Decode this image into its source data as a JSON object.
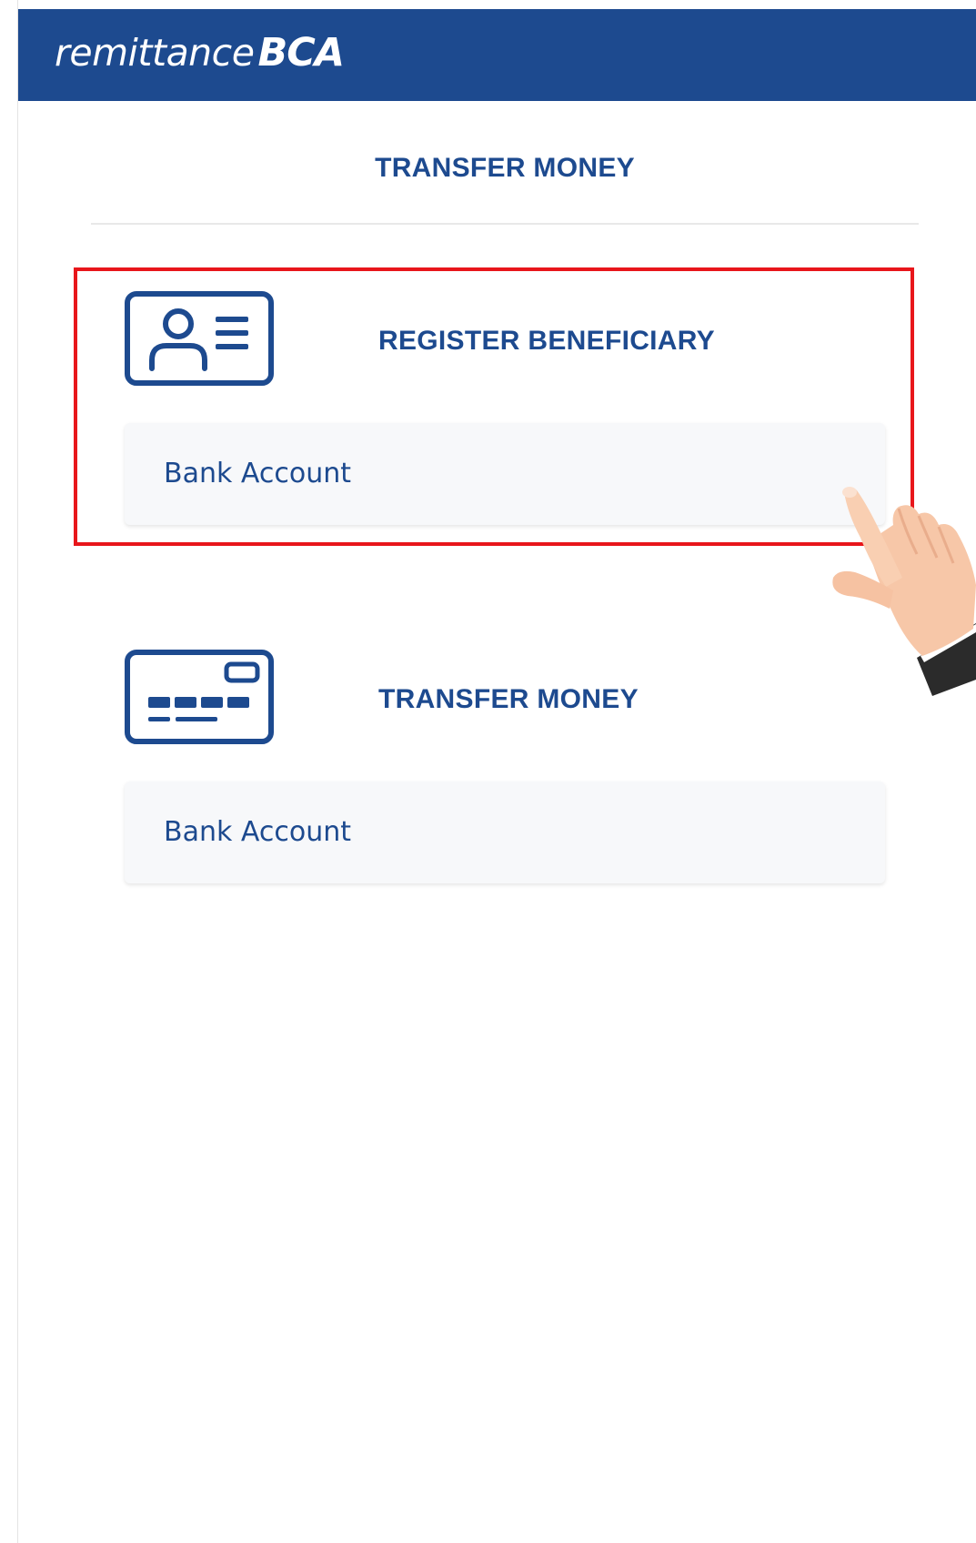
{
  "header": {
    "logo_word": "remittance",
    "logo_brand": "BCA",
    "background_color": "#1d4a8f"
  },
  "page_title": "TRANSFER MONEY",
  "sections": [
    {
      "icon": "id-card-icon",
      "title": "REGISTER BENEFICIARY",
      "option_label": "Bank Account",
      "highlighted": true
    },
    {
      "icon": "credit-card-icon",
      "title": "TRANSFER MONEY",
      "option_label": "Bank Account",
      "highlighted": false
    }
  ],
  "annotation": {
    "highlight_color": "#e8161b",
    "pointer_icon": "pointing-hand-icon"
  },
  "colors": {
    "primary": "#1d4a8f",
    "card_background": "#f7f8fa"
  }
}
